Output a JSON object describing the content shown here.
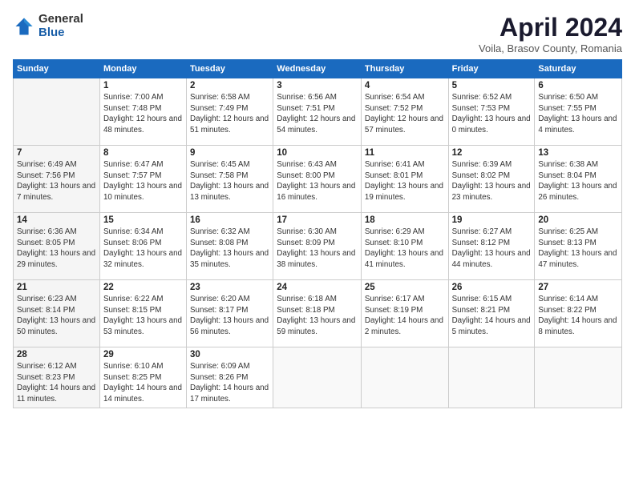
{
  "header": {
    "logo_general": "General",
    "logo_blue": "Blue",
    "title": "April 2024",
    "subtitle": "Voila, Brasov County, Romania"
  },
  "weekdays": [
    "Sunday",
    "Monday",
    "Tuesday",
    "Wednesday",
    "Thursday",
    "Friday",
    "Saturday"
  ],
  "weeks": [
    [
      {
        "day": "",
        "sunrise": "",
        "sunset": "",
        "daylight": ""
      },
      {
        "day": "1",
        "sunrise": "Sunrise: 7:00 AM",
        "sunset": "Sunset: 7:48 PM",
        "daylight": "Daylight: 12 hours and 48 minutes."
      },
      {
        "day": "2",
        "sunrise": "Sunrise: 6:58 AM",
        "sunset": "Sunset: 7:49 PM",
        "daylight": "Daylight: 12 hours and 51 minutes."
      },
      {
        "day": "3",
        "sunrise": "Sunrise: 6:56 AM",
        "sunset": "Sunset: 7:51 PM",
        "daylight": "Daylight: 12 hours and 54 minutes."
      },
      {
        "day": "4",
        "sunrise": "Sunrise: 6:54 AM",
        "sunset": "Sunset: 7:52 PM",
        "daylight": "Daylight: 12 hours and 57 minutes."
      },
      {
        "day": "5",
        "sunrise": "Sunrise: 6:52 AM",
        "sunset": "Sunset: 7:53 PM",
        "daylight": "Daylight: 13 hours and 0 minutes."
      },
      {
        "day": "6",
        "sunrise": "Sunrise: 6:50 AM",
        "sunset": "Sunset: 7:55 PM",
        "daylight": "Daylight: 13 hours and 4 minutes."
      }
    ],
    [
      {
        "day": "7",
        "sunrise": "Sunrise: 6:49 AM",
        "sunset": "Sunset: 7:56 PM",
        "daylight": "Daylight: 13 hours and 7 minutes."
      },
      {
        "day": "8",
        "sunrise": "Sunrise: 6:47 AM",
        "sunset": "Sunset: 7:57 PM",
        "daylight": "Daylight: 13 hours and 10 minutes."
      },
      {
        "day": "9",
        "sunrise": "Sunrise: 6:45 AM",
        "sunset": "Sunset: 7:58 PM",
        "daylight": "Daylight: 13 hours and 13 minutes."
      },
      {
        "day": "10",
        "sunrise": "Sunrise: 6:43 AM",
        "sunset": "Sunset: 8:00 PM",
        "daylight": "Daylight: 13 hours and 16 minutes."
      },
      {
        "day": "11",
        "sunrise": "Sunrise: 6:41 AM",
        "sunset": "Sunset: 8:01 PM",
        "daylight": "Daylight: 13 hours and 19 minutes."
      },
      {
        "day": "12",
        "sunrise": "Sunrise: 6:39 AM",
        "sunset": "Sunset: 8:02 PM",
        "daylight": "Daylight: 13 hours and 23 minutes."
      },
      {
        "day": "13",
        "sunrise": "Sunrise: 6:38 AM",
        "sunset": "Sunset: 8:04 PM",
        "daylight": "Daylight: 13 hours and 26 minutes."
      }
    ],
    [
      {
        "day": "14",
        "sunrise": "Sunrise: 6:36 AM",
        "sunset": "Sunset: 8:05 PM",
        "daylight": "Daylight: 13 hours and 29 minutes."
      },
      {
        "day": "15",
        "sunrise": "Sunrise: 6:34 AM",
        "sunset": "Sunset: 8:06 PM",
        "daylight": "Daylight: 13 hours and 32 minutes."
      },
      {
        "day": "16",
        "sunrise": "Sunrise: 6:32 AM",
        "sunset": "Sunset: 8:08 PM",
        "daylight": "Daylight: 13 hours and 35 minutes."
      },
      {
        "day": "17",
        "sunrise": "Sunrise: 6:30 AM",
        "sunset": "Sunset: 8:09 PM",
        "daylight": "Daylight: 13 hours and 38 minutes."
      },
      {
        "day": "18",
        "sunrise": "Sunrise: 6:29 AM",
        "sunset": "Sunset: 8:10 PM",
        "daylight": "Daylight: 13 hours and 41 minutes."
      },
      {
        "day": "19",
        "sunrise": "Sunrise: 6:27 AM",
        "sunset": "Sunset: 8:12 PM",
        "daylight": "Daylight: 13 hours and 44 minutes."
      },
      {
        "day": "20",
        "sunrise": "Sunrise: 6:25 AM",
        "sunset": "Sunset: 8:13 PM",
        "daylight": "Daylight: 13 hours and 47 minutes."
      }
    ],
    [
      {
        "day": "21",
        "sunrise": "Sunrise: 6:23 AM",
        "sunset": "Sunset: 8:14 PM",
        "daylight": "Daylight: 13 hours and 50 minutes."
      },
      {
        "day": "22",
        "sunrise": "Sunrise: 6:22 AM",
        "sunset": "Sunset: 8:15 PM",
        "daylight": "Daylight: 13 hours and 53 minutes."
      },
      {
        "day": "23",
        "sunrise": "Sunrise: 6:20 AM",
        "sunset": "Sunset: 8:17 PM",
        "daylight": "Daylight: 13 hours and 56 minutes."
      },
      {
        "day": "24",
        "sunrise": "Sunrise: 6:18 AM",
        "sunset": "Sunset: 8:18 PM",
        "daylight": "Daylight: 13 hours and 59 minutes."
      },
      {
        "day": "25",
        "sunrise": "Sunrise: 6:17 AM",
        "sunset": "Sunset: 8:19 PM",
        "daylight": "Daylight: 14 hours and 2 minutes."
      },
      {
        "day": "26",
        "sunrise": "Sunrise: 6:15 AM",
        "sunset": "Sunset: 8:21 PM",
        "daylight": "Daylight: 14 hours and 5 minutes."
      },
      {
        "day": "27",
        "sunrise": "Sunrise: 6:14 AM",
        "sunset": "Sunset: 8:22 PM",
        "daylight": "Daylight: 14 hours and 8 minutes."
      }
    ],
    [
      {
        "day": "28",
        "sunrise": "Sunrise: 6:12 AM",
        "sunset": "Sunset: 8:23 PM",
        "daylight": "Daylight: 14 hours and 11 minutes."
      },
      {
        "day": "29",
        "sunrise": "Sunrise: 6:10 AM",
        "sunset": "Sunset: 8:25 PM",
        "daylight": "Daylight: 14 hours and 14 minutes."
      },
      {
        "day": "30",
        "sunrise": "Sunrise: 6:09 AM",
        "sunset": "Sunset: 8:26 PM",
        "daylight": "Daylight: 14 hours and 17 minutes."
      },
      {
        "day": "",
        "sunrise": "",
        "sunset": "",
        "daylight": ""
      },
      {
        "day": "",
        "sunrise": "",
        "sunset": "",
        "daylight": ""
      },
      {
        "day": "",
        "sunrise": "",
        "sunset": "",
        "daylight": ""
      },
      {
        "day": "",
        "sunrise": "",
        "sunset": "",
        "daylight": ""
      }
    ]
  ]
}
